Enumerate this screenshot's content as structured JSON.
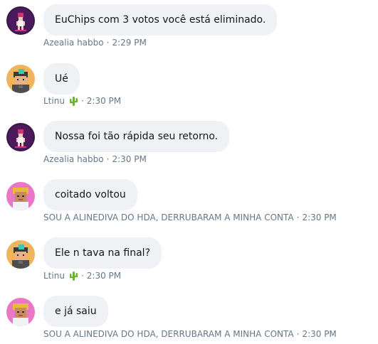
{
  "messages": [
    {
      "avatar": "azealia-avatar",
      "text": "EuChips com 3 votos você está eliminado.",
      "sender": "Azealia habbo",
      "separator": "·",
      "time": "2:29 PM",
      "emoji": ""
    },
    {
      "avatar": "ltinu-avatar",
      "text": "Ué",
      "sender": "Ltinu",
      "separator": "·",
      "time": "2:30 PM",
      "emoji": "cactus-icon"
    },
    {
      "avatar": "azealia-avatar",
      "text": "Nossa foi tão rápida seu retorno.",
      "sender": "Azealia habbo",
      "separator": "·",
      "time": "2:30 PM",
      "emoji": ""
    },
    {
      "avatar": "alinediva-avatar",
      "text": "coitado voltou",
      "sender": "SOU A ALINEDIVA DO HDA, DERRUBARAM A MINHA CONTA",
      "separator": "·",
      "time": "2:30 PM",
      "emoji": ""
    },
    {
      "avatar": "ltinu-avatar",
      "text": "Ele n tava na final?",
      "sender": "Ltinu",
      "separator": "·",
      "time": "2:30 PM",
      "emoji": "cactus-icon"
    },
    {
      "avatar": "alinediva-avatar",
      "text": "e já saiu",
      "sender": "SOU A ALINEDIVA DO HDA, DERRUBARAM A MINHA CONTA",
      "separator": "·",
      "time": "2:30 PM",
      "emoji": ""
    }
  ],
  "colors": {
    "bubble_bg": "#eff1f4",
    "text": "#14171a",
    "meta": "#657786",
    "azealia_bg": "#3b1548",
    "ltinu_bg": "#f0b45c",
    "alinediva_bg": "#e877c6"
  }
}
